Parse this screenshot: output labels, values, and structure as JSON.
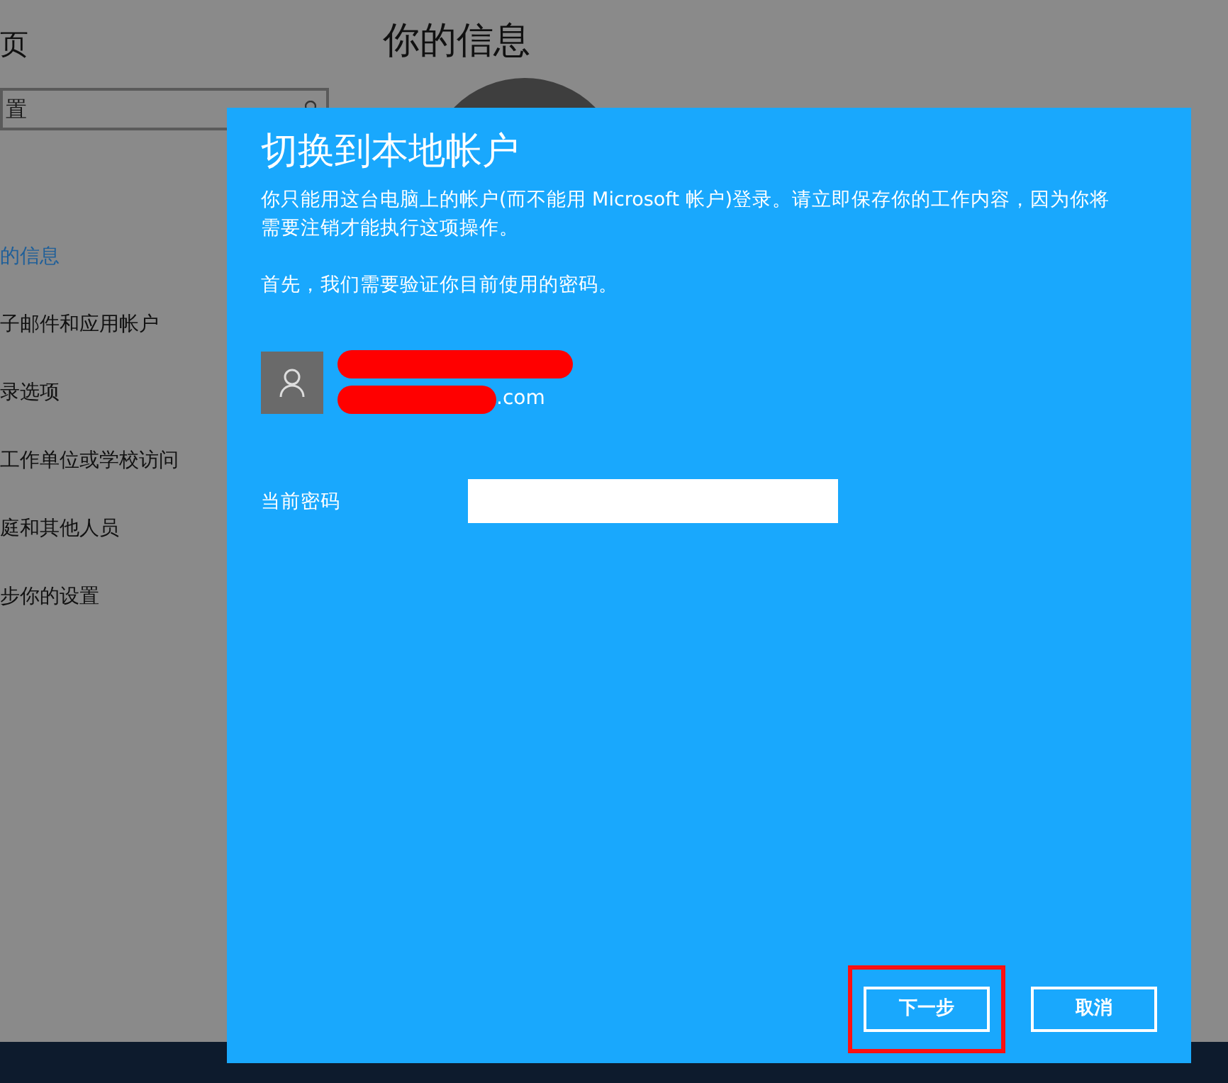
{
  "background": {
    "header": "页",
    "search": {
      "placeholder": "置"
    },
    "title": "你的信息",
    "nav": [
      {
        "label": "的信息",
        "selected": true
      },
      {
        "label": "子邮件和应用帐户",
        "selected": false
      },
      {
        "label": "录选项",
        "selected": false
      },
      {
        "label": "工作单位或学校访问",
        "selected": false
      },
      {
        "label": "庭和其他人员",
        "selected": false
      },
      {
        "label": "步你的设置",
        "selected": false
      }
    ]
  },
  "dialog": {
    "title": "切换到本地帐户",
    "message": "你只能用这台电脑上的帐户(而不能用 Microsoft 帐户)登录。请立即保存你的工作内容，因为你将需要注销才能执行这项操作。",
    "prompt": "首先，我们需要验证你目前使用的密码。",
    "account": {
      "email_end": ".com"
    },
    "password": {
      "label": "当前密码"
    },
    "buttons": [
      {
        "label": "下一步",
        "highlighted": true
      },
      {
        "label": "取消",
        "highlighted": false
      }
    ]
  }
}
